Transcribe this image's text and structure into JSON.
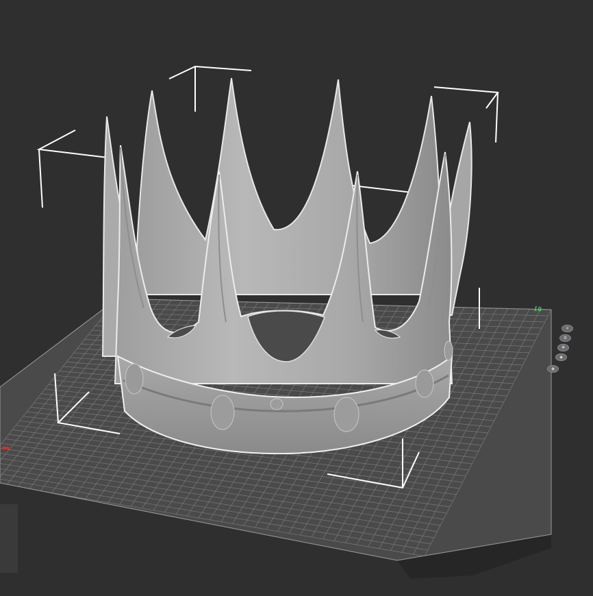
{
  "viewport": {
    "model": "crown",
    "plate_id": "01"
  },
  "plate_buttons": [
    {
      "icon": "close-icon",
      "glyph": "✕"
    },
    {
      "icon": "settings-icon",
      "glyph": "⚙"
    },
    {
      "icon": "move-icon",
      "glyph": "✥"
    },
    {
      "icon": "lock-icon",
      "glyph": "◆"
    },
    {
      "icon": "target-icon",
      "glyph": "◉"
    }
  ],
  "colors": {
    "background": "#2f2f30",
    "plate": "#4a4a4b",
    "grid": "#8a8a8b",
    "model": "#b4b4b4",
    "label": "#4ff06a"
  }
}
